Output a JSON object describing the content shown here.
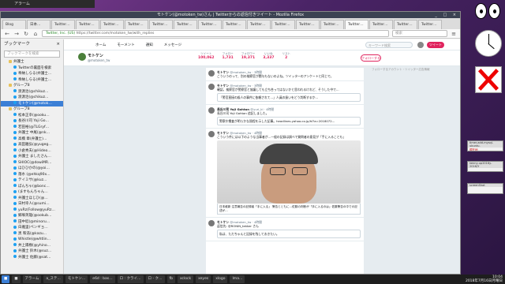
{
  "notification": "アラーム",
  "window": {
    "title": "モトケン(@motoken_tw)さん | Twitterからの返信付きツイート - Mozilla Firefox",
    "controls": "_ □ ×"
  },
  "tabs": [
    "Blog",
    "日本…",
    "Twitter…",
    "Twitter…",
    "Twitter…",
    "Twitter…",
    "Twitter…",
    "Twitter…",
    "Twitter…",
    "Twitter…",
    "Twitter…",
    "Twitter…",
    "Twitter…",
    "Twitter…",
    "Twitter…",
    "Twitter…",
    "Twitter…",
    "Twitter…"
  ],
  "navbar": {
    "back": "←",
    "forward": "→",
    "reload": "↻",
    "home": "⌂",
    "url_secure": "Twitter, Inc. (US)",
    "url": "https://twitter.com/motoken_tw/with_replies",
    "search_placeholder": "検索",
    "menu": "≡"
  },
  "sidebar": {
    "title": "ブックマーク",
    "close": "×",
    "search_placeholder": "ブックマークを検索",
    "items": [
      {
        "label": "弁護士",
        "type": "folder",
        "selected": false
      },
      {
        "label": "Twitterの裏面を検索",
        "type": "bird",
        "selected": false
      },
      {
        "label": "奉納しらる(弁護士…",
        "type": "bird",
        "selected": false
      },
      {
        "label": "奉納しらる(弁護士…",
        "type": "bird",
        "selected": false
      },
      {
        "label": "グループ8",
        "type": "folder",
        "selected": false
      },
      {
        "label": "渡源治(@chikuz…",
        "type": "bird",
        "selected": false
      },
      {
        "label": "渡源治(@chikuz…",
        "type": "bird",
        "selected": false
      },
      {
        "label": "モトケン(@motok…",
        "type": "bird",
        "selected": true
      },
      {
        "label": "グループ8",
        "type": "folder",
        "selected": false
      },
      {
        "label": "松本正幸(@ooku…",
        "type": "bird",
        "selected": false
      },
      {
        "label": "長谷川司 Yoji Go…",
        "type": "bird",
        "selected": false
      },
      {
        "label": "若田裕(@TLGryf…",
        "type": "bird",
        "selected": false
      },
      {
        "label": "弁護士 中尾(@nk…",
        "type": "bird",
        "selected": false
      },
      {
        "label": "高橋 章(弁護士)…",
        "type": "bird",
        "selected": false
      },
      {
        "label": "高田雅弘(@yugeg…",
        "type": "bird",
        "selected": false
      },
      {
        "label": "小倉秀夫(@Hideo…",
        "type": "bird",
        "selected": false
      },
      {
        "label": "弁護士 ましたさん…",
        "type": "bird",
        "selected": false
      },
      {
        "label": "SHIOC(@dowiMR…",
        "type": "bird",
        "selected": false
      },
      {
        "label": "ほひひかの(@yoi…",
        "type": "bird",
        "selected": false
      },
      {
        "label": "落水 (@ehkq90x…",
        "type": "bird",
        "selected": false
      },
      {
        "label": "テイミサ(@kuz…",
        "type": "bird",
        "selected": false
      },
      {
        "label": "ぼんちゃ(@bonc…",
        "type": "bird",
        "selected": false
      },
      {
        "label": "(ますもんちゃん…",
        "type": "bird",
        "selected": false
      },
      {
        "label": "弁護士ほじひ(@…",
        "type": "bird",
        "selected": false
      },
      {
        "label": "日村幸人(@sumi…",
        "type": "bird",
        "selected": false
      },
      {
        "label": "yuRz(Follow@yuRz…",
        "type": "bird",
        "selected": false
      },
      {
        "label": "郷塚英雄(@ookub…",
        "type": "bird",
        "selected": false
      },
      {
        "label": "田中稔(@minoru…",
        "type": "bird",
        "selected": false
      },
      {
        "label": "白雅里(ペンギョ…",
        "type": "bird",
        "selected": false
      },
      {
        "label": "黒 和浩(@kazu…",
        "type": "bird",
        "selected": false
      },
      {
        "label": "Whistle(@whtlin…",
        "type": "bird",
        "selected": false
      },
      {
        "label": "井上陽樹(@yhino…",
        "type": "bird",
        "selected": false
      },
      {
        "label": "弁護士 鈴木(@suz…",
        "type": "bird",
        "selected": false
      },
      {
        "label": "弁護士 佐藤(@sat…",
        "type": "bird",
        "selected": false
      }
    ]
  },
  "twitter": {
    "nav": [
      "ホーム",
      "モーメント",
      "通知",
      "メッセージ"
    ],
    "search_placeholder": "キーワード検索",
    "tweet_button": "ツイート",
    "profile": {
      "name": "モトケン",
      "handle": "@motoken_tw",
      "follow_button": "フォローする",
      "stats": [
        {
          "label": "ツイート",
          "value": "100,062"
        },
        {
          "label": "フォロー",
          "value": "1,731"
        },
        {
          "label": "フォロワー",
          "value": "19,371"
        },
        {
          "label": "いいね",
          "value": "3,337"
        },
        {
          "label": "リスト",
          "value": "2"
        }
      ]
    },
    "tweets": [
      {
        "header": "モトケン",
        "meta": "@motoken_tw · 3時間",
        "text": "こういうのって、別の検察官が関与もないのよね。ツイッターのアンケートと同じで。"
      },
      {
        "header": "モトケン",
        "meta": "@motoken_tw · 3時間",
        "text": "確認。検察官が警察官と協議しても立ち合ってはないかと思われるけれど、そうした中で…",
        "quote": "「警官直接の殺人の事件に依頼されて…」人員の扱いをどう判断するか…"
      },
      {
        "header": "長谷川司 Yoji Gohtan",
        "meta": "@yuri_kl · 4時間",
        "text": "長谷川司 Yoji Gohtan 追記しました。",
        "quote": "警察庁捜査が明らかな過程を示した記事。headlines.yahoo.co.jp/hl?a=2018072…"
      },
      {
        "header": "モトケン",
        "meta": "@motoken_tw · 4時間",
        "text": "こういう件には以下のような当事者が…一般の記録は調べで質問者の意見が「手に入ることも」",
        "caption": "日本維新 注意報告の記録者「手に入る」 警告とともに…佐藤の判断が「手に入るのは」佐藤警告の中での記述が…"
      },
      {
        "header": "モトケン",
        "meta": "@motoken_tw · 4時間",
        "text": "返信先: @RONIN_tekker さん",
        "quote": "私は、ただちゃんと記録を残しておきたい。"
      }
    ],
    "sidebar_right": "フォローするアカウント・ツイッター広告情報"
  },
  "desktop": {
    "dialogs": [
      {
        "title": "timer-add-mysql-ubuntu.",
        "text": "現在地"
      },
      {
        "title": "kenny-up2016y-2016/Y",
        "text": ""
      },
      {
        "title": "screenShot",
        "text": ""
      }
    ]
  },
  "taskbar": {
    "start": "■",
    "items": [
      "■",
      "アラーム",
      "a_ステ…",
      "モトケン…",
      "e6d : bas…",
      "ロ : クライ…",
      "ロ - ク…",
      "fb",
      "xclock",
      "xeyes",
      "xlogo",
      "Ima…"
    ],
    "time": "10:04",
    "date": "2018年7月16日月曜日"
  }
}
